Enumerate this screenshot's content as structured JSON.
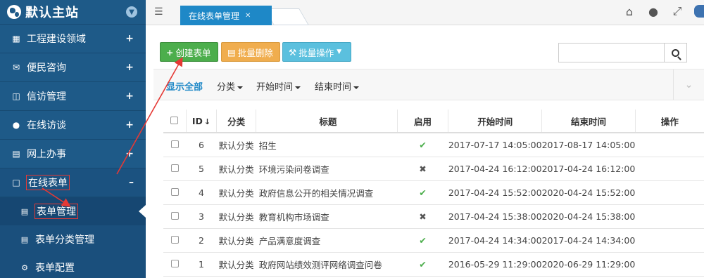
{
  "sidebar": {
    "site_title": "默认主站",
    "items": [
      {
        "label": "工程建设领域",
        "icon": "building-icon"
      },
      {
        "label": "便民咨询",
        "icon": "envelope-icon"
      },
      {
        "label": "信访管理",
        "icon": "inbox-icon"
      },
      {
        "label": "在线访谈",
        "icon": "microphone-icon"
      },
      {
        "label": "网上办事",
        "icon": "sitemap-icon"
      },
      {
        "label": "在线表单",
        "icon": "document-icon"
      }
    ],
    "subitems": [
      {
        "label": "表单管理",
        "icon": "list-icon"
      },
      {
        "label": "表单分类管理",
        "icon": "list-icon"
      },
      {
        "label": "表单配置",
        "icon": "gear-icon"
      }
    ]
  },
  "topbar": {
    "tab_label": "在线表单管理"
  },
  "toolbar": {
    "create_label": "创建表单",
    "batch_delete_label": "批量删除",
    "batch_ops_label": "批量操作",
    "search_placeholder": ""
  },
  "filters": {
    "show_all": "显示全部",
    "category": "分类",
    "start_time": "开始时间",
    "end_time": "结束时间"
  },
  "table": {
    "headers": {
      "id": "ID",
      "category": "分类",
      "title": "标题",
      "enabled": "启用",
      "start": "开始时间",
      "end": "结束时间",
      "ops": "操作"
    },
    "rows": [
      {
        "id": "6",
        "category": "默认分类",
        "title": "招生",
        "enabled": true,
        "start": "2017-07-17 14:05:00",
        "end": "2017-08-17 14:05:00"
      },
      {
        "id": "5",
        "category": "默认分类",
        "title": "环境污染问卷调查",
        "enabled": false,
        "start": "2017-04-24 16:12:00",
        "end": "2017-04-24 16:12:00"
      },
      {
        "id": "4",
        "category": "默认分类",
        "title": "政府信息公开的相关情况调查",
        "enabled": true,
        "start": "2017-04-24 15:52:00",
        "end": "2020-04-24 15:52:00"
      },
      {
        "id": "3",
        "category": "默认分类",
        "title": "教育机构市场调查",
        "enabled": false,
        "start": "2017-04-24 15:38:00",
        "end": "2020-04-24 15:38:00"
      },
      {
        "id": "2",
        "category": "默认分类",
        "title": "产品满意度调查",
        "enabled": true,
        "start": "2017-04-24 14:34:00",
        "end": "2017-04-24 14:34:00"
      },
      {
        "id": "1",
        "category": "默认分类",
        "title": "政府网站绩效测评网络调查问卷",
        "enabled": true,
        "start": "2016-05-29 11:29:00",
        "end": "2020-06-29 11:29:00"
      }
    ]
  },
  "colors": {
    "sidebar": "#1e5a88",
    "tab": "#1e88c7",
    "create": "#4cae4c",
    "delete": "#f0ad4e",
    "batch": "#5bc0de",
    "annotation": "#e53935"
  }
}
